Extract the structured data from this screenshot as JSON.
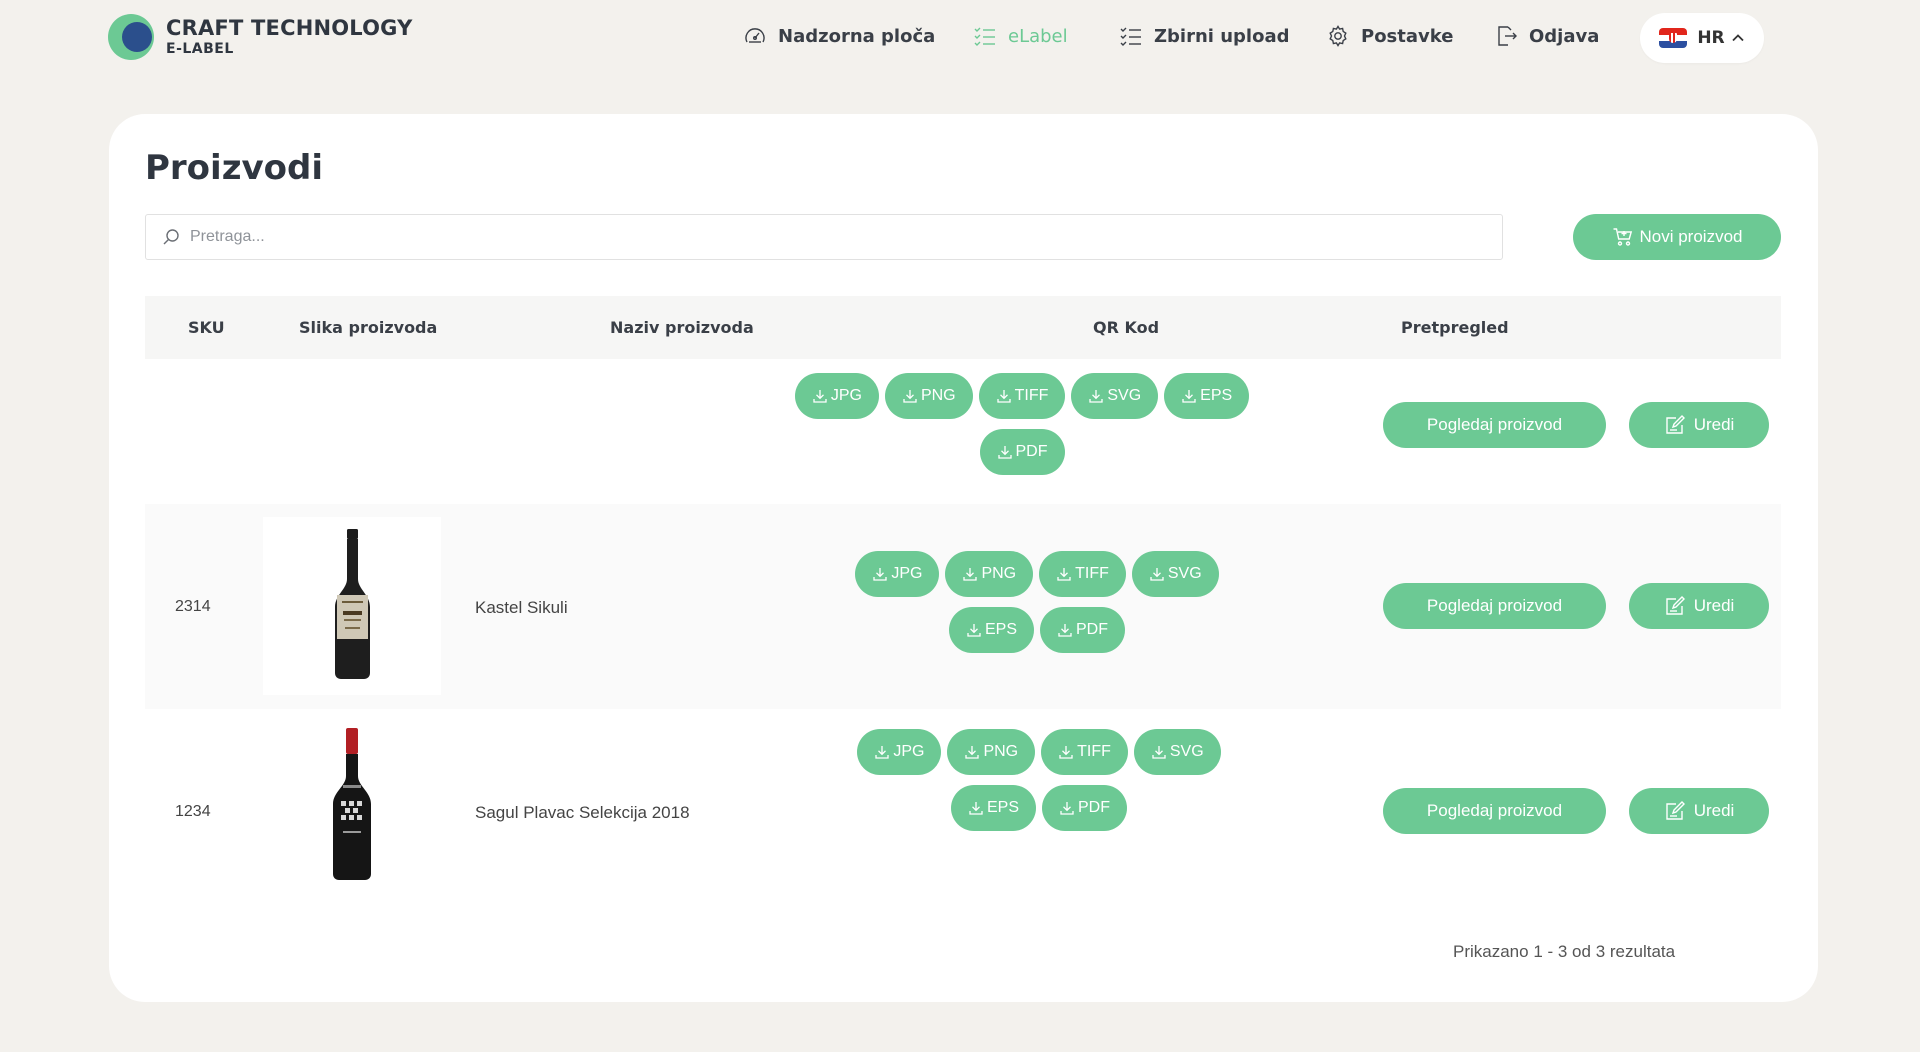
{
  "brand": {
    "title": "CRAFT TECHNOLOGY",
    "subtitle": "E-LABEL",
    "colors": {
      "accent": "#6cc994",
      "logo_inner": "#2b4f8c",
      "text_dark": "#2f3640",
      "background": "#f3f1ed"
    }
  },
  "nav": {
    "items": [
      {
        "label": "Nadzorna ploča",
        "icon": "speedometer-icon",
        "active": false
      },
      {
        "label": "eLabel",
        "icon": "checklist-icon",
        "active": true
      },
      {
        "label": "Zbirni upload",
        "icon": "checklist-icon",
        "active": false
      },
      {
        "label": "Postavke",
        "icon": "gear-icon",
        "active": false
      },
      {
        "label": "Odjava",
        "icon": "logout-icon",
        "active": false
      }
    ],
    "language": {
      "code": "HR",
      "flag": "croatia-flag-icon"
    }
  },
  "page": {
    "title": "Proizvodi",
    "search_placeholder": "Pretraga...",
    "search_value": "",
    "new_product_label": "Novi proizvod"
  },
  "table": {
    "columns": {
      "sku": "SKU",
      "image": "Slika proizvoda",
      "name": "Naziv proizvoda",
      "qr": "QR Kod",
      "preview": "Pretpregled"
    },
    "rows": [
      {
        "sku": "",
        "name": "",
        "has_image": false,
        "qr_formats": [
          "JPG",
          "PNG",
          "TIFF",
          "SVG",
          "EPS",
          "PDF"
        ],
        "view_label": "Pogledaj proizvod",
        "edit_label": "Uredi"
      },
      {
        "sku": "2314",
        "name": "Kastel Sikuli",
        "has_image": true,
        "image_icon": "wine-bottle-icon",
        "qr_formats": [
          "JPG",
          "PNG",
          "TIFF",
          "SVG",
          "EPS",
          "PDF"
        ],
        "view_label": "Pogledaj proizvod",
        "edit_label": "Uredi"
      },
      {
        "sku": "1234",
        "name": "Sagul Plavac Selekcija 2018",
        "has_image": true,
        "image_icon": "wine-bottle-icon",
        "qr_formats": [
          "JPG",
          "PNG",
          "TIFF",
          "SVG",
          "EPS",
          "PDF"
        ],
        "view_label": "Pogledaj proizvod",
        "edit_label": "Uredi"
      }
    ]
  },
  "pagination": {
    "summary": "Prikazano 1 - 3 od 3 rezultata"
  }
}
